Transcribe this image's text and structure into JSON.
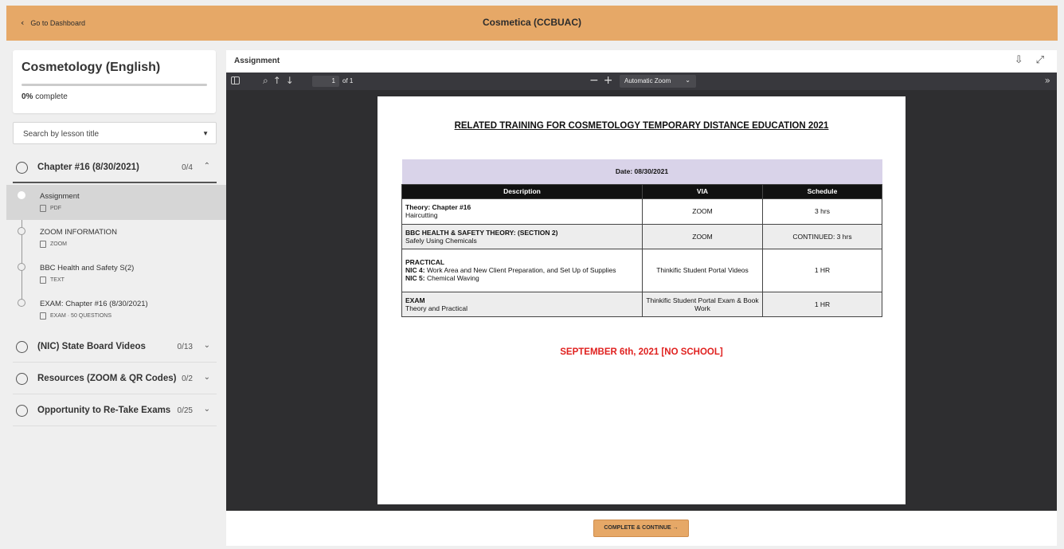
{
  "topbar": {
    "back_label": "Go to Dashboard",
    "back_icon": "chevron-left-icon",
    "title": "Cosmetica (CCBUAC)"
  },
  "sidebar": {
    "course_title": "Cosmetology (English)",
    "progress_value": "0%",
    "progress_fraction": 0,
    "progress_suffix": "complete",
    "search_placeholder": "Search by lesson title",
    "chapters": [
      {
        "title": "Chapter #16 (8/30/2021)",
        "count": "0/4",
        "expanded": true
      },
      {
        "title": "(NIC) State Board Videos",
        "count": "0/13",
        "expanded": false
      },
      {
        "title": "Resources (ZOOM & QR Codes)",
        "count": "0/2",
        "expanded": false
      },
      {
        "title": "Opportunity to Re-Take Exams",
        "count": "0/25",
        "expanded": false
      }
    ],
    "lessons": [
      {
        "title": "Assignment",
        "type": "PDF",
        "selected": true
      },
      {
        "title": "ZOOM INFORMATION",
        "type": "ZOOM",
        "selected": false
      },
      {
        "title": "BBC Health and Safety S(2)",
        "type": "TEXT",
        "selected": false
      },
      {
        "title": "EXAM: Chapter #16 (8/30/2021)",
        "type": "EXAM · 50 QUESTIONS",
        "selected": false
      }
    ]
  },
  "viewer": {
    "title": "Assignment",
    "page_current": "1",
    "page_total": "of 1",
    "zoom": "Automatic Zoom"
  },
  "document": {
    "title": "RELATED TRAINING FOR COSMETOLOGY TEMPORARY DISTANCE EDUCATION 2021",
    "date": "Date: 08/30/2021",
    "headers": [
      "Description",
      "VIA",
      "Schedule"
    ],
    "rows": [
      {
        "desc_bold": "Theory: Chapter #16",
        "desc": "Haircutting",
        "via": "ZOOM",
        "schedule": "3 hrs"
      },
      {
        "desc_bold": "BBC HEALTH & SAFETY THEORY: (SECTION 2)",
        "desc": "Safely Using Chemicals",
        "via": "ZOOM",
        "schedule": "CONTINUED: 3 hrs"
      },
      {
        "desc_bold": "PRACTICAL",
        "nic4_label": "NIC 4:",
        "nic4": "Work Area and New Client Preparation, and Set Up of Supplies",
        "nic5_label": "NIC 5:",
        "nic5": "Chemical Waving",
        "via": "Thinkific Student Portal Videos",
        "schedule": "1 HR"
      },
      {
        "desc_bold": "EXAM",
        "desc": "Theory and Practical",
        "via": "Thinkific Student Portal Exam & Book Work",
        "schedule": "1 HR"
      }
    ],
    "notice": "SEPTEMBER 6th, 2021 [NO SCHOOL]"
  },
  "footer": {
    "complete_label": "COMPLETE & CONTINUE →"
  },
  "colors": {
    "accent": "#e6a867",
    "viewer_bg": "#2e2e30",
    "notice": "#e0211f",
    "date_row": "#d9d3e9"
  }
}
